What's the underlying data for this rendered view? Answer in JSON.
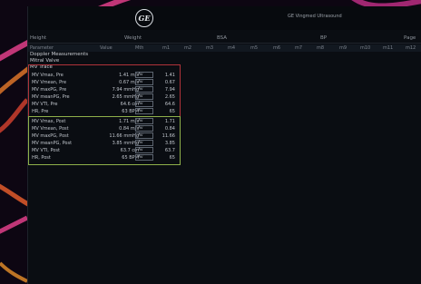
{
  "header": {
    "product": "GE Vingmed Ultrasound",
    "fields": {
      "height": "Height",
      "weight": "Weight",
      "bsa": "BSA",
      "bp": "BP",
      "page": "Page"
    }
  },
  "columns": {
    "parameter": "Parameter",
    "value": "Value",
    "mth": "Mth",
    "m": [
      "m1",
      "m2",
      "m3",
      "m4",
      "m5",
      "m6",
      "m7",
      "m8",
      "m9",
      "m10",
      "m11",
      "m12"
    ]
  },
  "sections": {
    "doppler": "Doppler Measurements",
    "mitral": "Mitral Valve",
    "trace": "MV Trace"
  },
  "pre_rows": [
    {
      "name": "MV Vmax, Pre",
      "value": "1.41 m/s",
      "mth": "Av",
      "m1": "1.41"
    },
    {
      "name": "MV Vmean, Pre",
      "value": "0.67 m/s",
      "mth": "Av",
      "m1": "0.67"
    },
    {
      "name": "MV maxPG, Pre",
      "value": "7.94 mmHg",
      "mth": "Av",
      "m1": "7.94"
    },
    {
      "name": "MV meanPG, Pre",
      "value": "2.65 mmHg",
      "mth": "Av",
      "m1": "2.65"
    },
    {
      "name": "MV VTI, Pre",
      "value": "64.6 cm",
      "mth": "Av",
      "m1": "64.6"
    },
    {
      "name": "HR, Pre",
      "value": "63 BPM",
      "mth": "Av",
      "m1": "65"
    }
  ],
  "post_rows": [
    {
      "name": "MV Vmax, Post",
      "value": "1.71 m/s",
      "mth": "Av",
      "m1": "1.71"
    },
    {
      "name": "MV Vmean, Post",
      "value": "0.84 m/s",
      "mth": "Av",
      "m1": "0.84"
    },
    {
      "name": "MV maxPG, Post",
      "value": "11.66 mmHg",
      "mth": "Av",
      "m1": "11.66"
    },
    {
      "name": "MV meanPG, Post",
      "value": "3.85 mmHg",
      "mth": "Av",
      "m1": "3.85"
    },
    {
      "name": "MV VTI, Post",
      "value": "63.7 cm",
      "mth": "Av",
      "m1": "63.7"
    },
    {
      "name": "HR, Post",
      "value": "65 BPM",
      "mth": "Av",
      "m1": "65"
    }
  ],
  "colors": {
    "pre_border": "#b0333a",
    "post_border": "#8fb04a",
    "background": "#0a0d12"
  }
}
